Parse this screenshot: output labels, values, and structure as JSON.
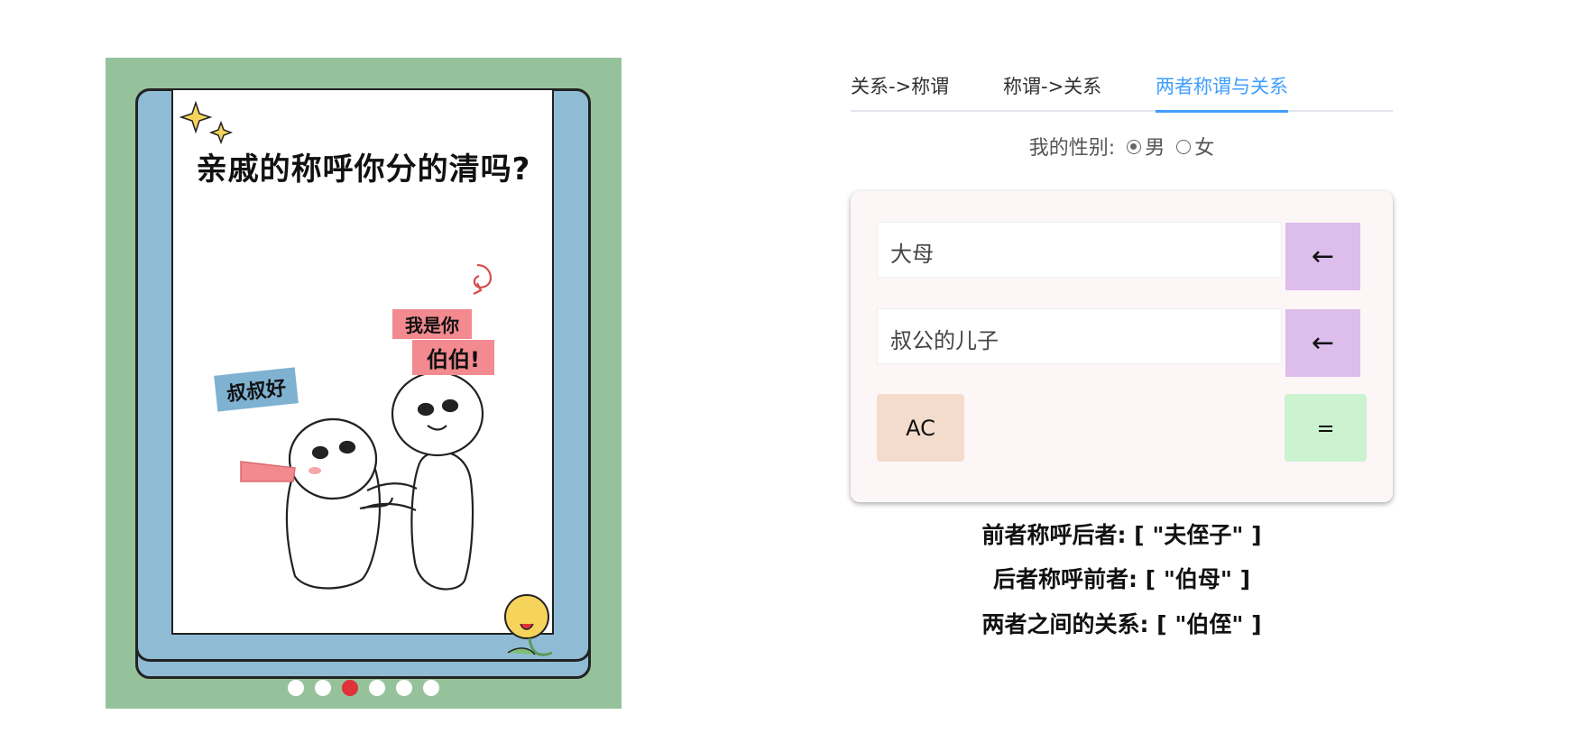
{
  "carousel": {
    "poster_title": "亲戚的称呼你分的清吗?",
    "sticker_left": "叔叔好",
    "sticker_right_line1": "我是你",
    "sticker_right_line2": "伯伯!",
    "slide_count": 6,
    "active_slide": 3
  },
  "tabs": [
    {
      "label": "关系->称谓",
      "active": false
    },
    {
      "label": "称谓->关系",
      "active": false
    },
    {
      "label": "两者称谓与关系",
      "active": true
    }
  ],
  "gender": {
    "label": "我的性别:",
    "options": [
      {
        "label": "男",
        "checked": true
      },
      {
        "label": "女",
        "checked": false
      }
    ]
  },
  "calculator": {
    "input1": "大母",
    "input2": "叔公的儿子",
    "backspace_label": "←",
    "clear_label": "AC",
    "equals_label": "="
  },
  "results": {
    "line1": "前者称呼后者: [ \"夫侄子\" ]",
    "line2": "后者称呼前者: [ \"伯母\" ]",
    "line3": "两者之间的关系: [ \"伯侄\" ]"
  },
  "colors": {
    "accent": "#409eff",
    "carousel_bg": "#95c29b",
    "book_blue": "#8fbcd4",
    "active_dot": "#e0323a",
    "backspace_bg": "#ddbdeb",
    "clear_bg": "#f4dccd",
    "equals_bg": "#cbf3d0",
    "panel_bg": "#fdf6f7"
  }
}
